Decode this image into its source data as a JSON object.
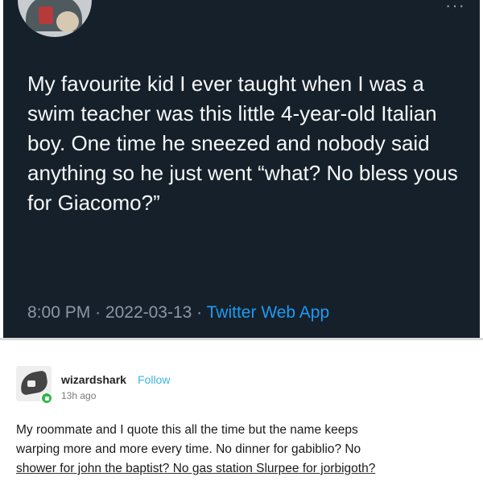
{
  "tweet": {
    "more": "···",
    "text": "My favourite kid I ever taught when I was a swim teacher was this little 4-year-old Italian boy. One time he sneezed and nobody said anything so he just went “what? No bless yous for Giacomo?”",
    "time": "8:00 PM",
    "date": "2022-03-13",
    "separator": "·",
    "app": "Twitter Web App"
  },
  "post": {
    "username": "wizardshark",
    "follow_label": "Follow",
    "time": "13h ago",
    "body_lines": [
      "My roommate and I quote this all the time but the name keeps",
      "warping more and more every time. No dinner for gabiblio? No",
      "shower for john the baptist? No gas station Slurpee for jorbigoth?"
    ]
  }
}
